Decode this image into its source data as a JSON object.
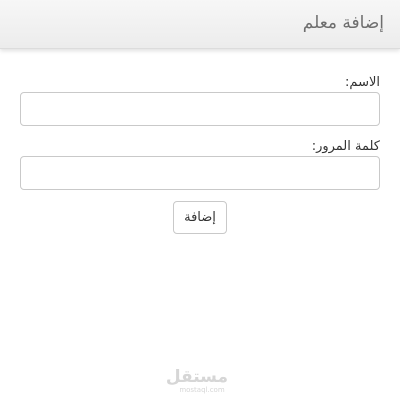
{
  "header": {
    "title": "إضافة معلم"
  },
  "form": {
    "name_label": "الاسم:",
    "name_value": "",
    "password_label": "كلمة المرور:",
    "password_value": "",
    "submit_label": "إضافة"
  },
  "watermark": {
    "logo_text": "مستقل",
    "sub_text": "mostaql.com"
  },
  "colors": {
    "header_bg": "#ececec",
    "header_title": "#6e6e6e",
    "border": "#c9c9c9",
    "text": "#333333"
  }
}
